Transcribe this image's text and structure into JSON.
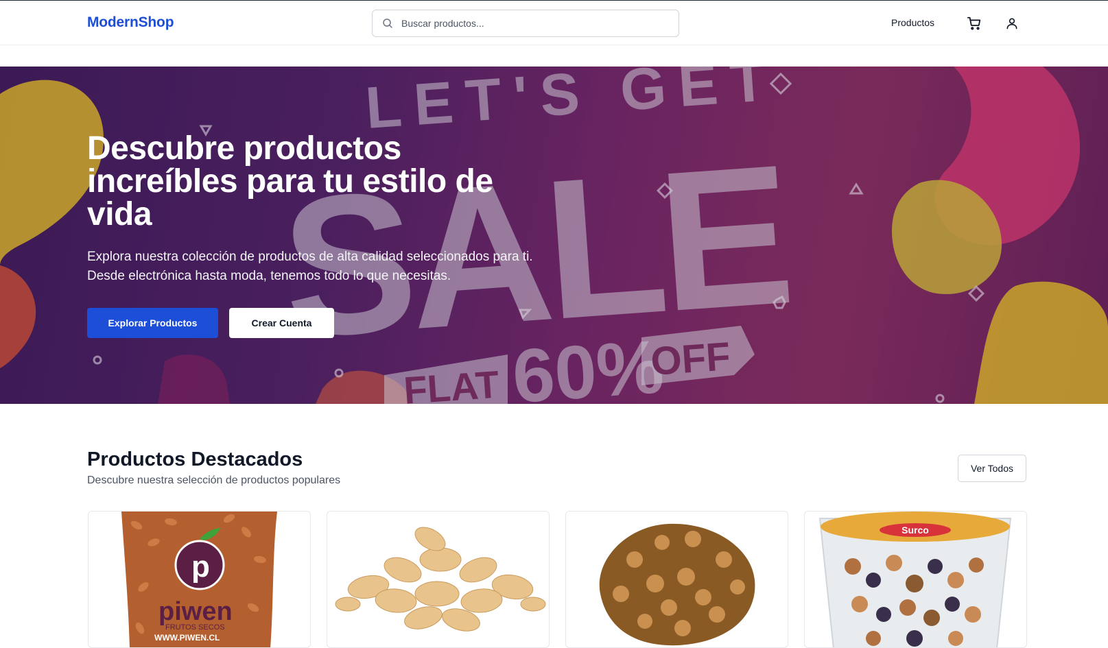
{
  "header": {
    "logo": "ModernShop",
    "search_placeholder": "Buscar productos...",
    "nav_products": "Productos",
    "icons": [
      "search-icon",
      "cart-icon",
      "user-icon"
    ]
  },
  "hero": {
    "title": "Descubre productos increíbles para tu estilo de vida",
    "description": "Explora nuestra colección de productos de alta calidad seleccionados para ti. Desde electrónica hasta moda, tenemos todo lo que necesitas.",
    "primary_button": "Explorar Productos",
    "secondary_button": "Crear Cuenta",
    "banner_text": {
      "line1": "LET'S GET",
      "line2": "SALE",
      "flat": "FLAT",
      "percent": "60%",
      "off": "OFF"
    }
  },
  "featured": {
    "title": "Productos Destacados",
    "subtitle": "Descubre nuestra selección de productos populares",
    "view_all": "Ver Todos",
    "products": [
      {
        "image": "almonds-bag",
        "brand_letter": "p",
        "brand": "piwen",
        "brand_tag": "FRUTOS SECOS",
        "brand_url": "WWW.PIWEN.CL"
      },
      {
        "image": "peanuts"
      },
      {
        "image": "walnuts"
      },
      {
        "image": "mixed-nuts-tub",
        "brand": "Surco"
      }
    ]
  },
  "colors": {
    "brand_blue": "#1d4ed8",
    "hero_purple": "#4a1f5e",
    "hero_magenta": "#7a2a5a"
  }
}
